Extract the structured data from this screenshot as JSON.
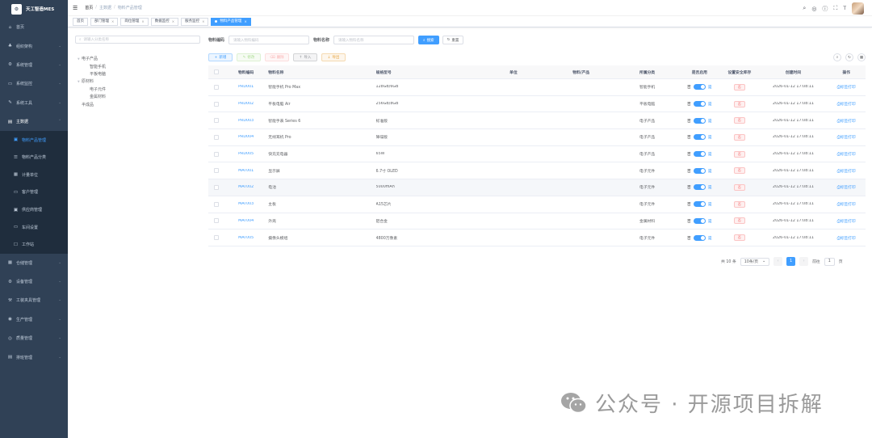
{
  "app": {
    "title": "天工智造MES"
  },
  "sidebar": {
    "items": [
      {
        "label": "首页",
        "icon": "home-icon",
        "glyph": "⌂",
        "has_arrow": false
      },
      {
        "label": "组织架构",
        "icon": "org-icon",
        "glyph": "♣",
        "has_arrow": true
      },
      {
        "label": "系统管理",
        "icon": "gear-icon",
        "glyph": "⚙",
        "has_arrow": true
      },
      {
        "label": "系统监控",
        "icon": "monitor-icon",
        "glyph": "▭",
        "has_arrow": true
      },
      {
        "label": "系统工具",
        "icon": "tool-icon",
        "glyph": "✎",
        "has_arrow": true
      },
      {
        "label": "主数据",
        "icon": "data-icon",
        "glyph": "▤",
        "has_arrow": true,
        "open": true
      }
    ],
    "subitems": [
      {
        "label": "物料产品管理",
        "icon": "product-icon",
        "glyph": "▣",
        "active": true
      },
      {
        "label": "物料产品分类",
        "icon": "category-icon",
        "glyph": "☰"
      },
      {
        "label": "计量单位",
        "icon": "unit-icon",
        "glyph": "▦"
      },
      {
        "label": "客户管理",
        "icon": "customer-icon",
        "glyph": "▭"
      },
      {
        "label": "供应商管理",
        "icon": "supplier-icon",
        "glyph": "▣"
      },
      {
        "label": "车间设置",
        "icon": "workshop-icon",
        "glyph": "▭"
      },
      {
        "label": "工作站",
        "icon": "workstation-icon",
        "glyph": "☐"
      }
    ],
    "items2": [
      {
        "label": "仓储管理",
        "icon": "warehouse-icon",
        "glyph": "▦"
      },
      {
        "label": "设备管理",
        "icon": "device-icon",
        "glyph": "⚙"
      },
      {
        "label": "工装夹具管理",
        "icon": "fixture-icon",
        "glyph": "⚒"
      },
      {
        "label": "生产管理",
        "icon": "production-icon",
        "glyph": "◉"
      },
      {
        "label": "质量管理",
        "icon": "quality-icon",
        "glyph": "◎"
      },
      {
        "label": "排班管理",
        "icon": "schedule-icon",
        "glyph": "▤"
      }
    ]
  },
  "breadcrumb": {
    "items": [
      "首页",
      "主数据",
      "物料产品管理"
    ]
  },
  "tags": [
    {
      "label": "首页",
      "closable": false
    },
    {
      "label": "部门管理",
      "closable": true
    },
    {
      "label": "岗位管理",
      "closable": true
    },
    {
      "label": "数据监控",
      "closable": true
    },
    {
      "label": "服务监控",
      "closable": true
    },
    {
      "label": "物料产品管理",
      "closable": true,
      "active": true
    }
  ],
  "tree": {
    "search_placeholder": "请输入分类名称",
    "nodes": [
      {
        "label": "电子产品",
        "level": 0,
        "caret": true
      },
      {
        "label": "智能手机",
        "level": 1
      },
      {
        "label": "平板电脑",
        "level": 1
      },
      {
        "label": "原材料",
        "level": 0,
        "caret": true
      },
      {
        "label": "电子元件",
        "level": 1
      },
      {
        "label": "金属材料",
        "level": 1
      },
      {
        "label": "半成品",
        "level": 0
      }
    ]
  },
  "search": {
    "code_label": "物料编码",
    "code_placeholder": "请输入物料编码",
    "name_label": "物料名称",
    "name_placeholder": "请输入物料名称",
    "search_btn": "搜索",
    "reset_btn": "重置"
  },
  "toolbar": {
    "add": "新增",
    "edit": "修改",
    "delete": "删除",
    "import": "导入",
    "export": "导出"
  },
  "table": {
    "headers": [
      "物料编码",
      "物料名称",
      "规格型号",
      "单位",
      "物料/产品",
      "所属分类",
      "是否启用",
      "设置安全库存",
      "创建时间",
      "操作"
    ],
    "switch_no": "否",
    "switch_yes": "是",
    "safe_btn": "否",
    "action": "标签打印",
    "rows": [
      {
        "code": "PRD001",
        "name": "智能手机 Pro Max",
        "spec": "128GB/6GB",
        "unit": "",
        "type": "",
        "category": "智能手机",
        "created": "2026-01-12 17:08:11"
      },
      {
        "code": "PRD002",
        "name": "平板电脑 Air",
        "spec": "256GB/8GB",
        "unit": "",
        "type": "",
        "category": "平板电脑",
        "created": "2026-01-12 17:08:11"
      },
      {
        "code": "PRD003",
        "name": "智能手表 Series 6",
        "spec": "标准版",
        "unit": "",
        "type": "",
        "category": "电子产品",
        "created": "2026-01-12 17:08:11"
      },
      {
        "code": "PRD004",
        "name": "无线耳机 Pro",
        "spec": "降噪版",
        "unit": "",
        "type": "",
        "category": "电子产品",
        "created": "2026-01-12 17:08:11"
      },
      {
        "code": "PRD005",
        "name": "快充充电器",
        "spec": "65W",
        "unit": "",
        "type": "",
        "category": "电子产品",
        "created": "2026-01-12 17:08:11"
      },
      {
        "code": "MAT001",
        "name": "显示屏",
        "spec": "6.7寸 OLED",
        "unit": "",
        "type": "",
        "category": "电子元件",
        "created": "2026-01-12 17:08:11"
      },
      {
        "code": "MAT002",
        "name": "电池",
        "spec": "5000mAh",
        "unit": "",
        "type": "",
        "category": "电子元件",
        "created": "2026-01-12 17:08:11"
      },
      {
        "code": "MAT003",
        "name": "主板",
        "spec": "A15芯片",
        "unit": "",
        "type": "",
        "category": "电子元件",
        "created": "2026-01-12 17:08:11"
      },
      {
        "code": "MAT004",
        "name": "外壳",
        "spec": "铝合金",
        "unit": "",
        "type": "",
        "category": "金属材料",
        "created": "2026-01-12 17:08:11"
      },
      {
        "code": "MAT005",
        "name": "摄像头模组",
        "spec": "4800万像素",
        "unit": "",
        "type": "",
        "category": "电子元件",
        "created": "2026-01-12 17:08:11"
      }
    ]
  },
  "pager": {
    "total": "共 10 条",
    "size": "10条/页",
    "page": "1",
    "goto": "前往",
    "goto_val": "1",
    "unit": "页"
  },
  "watermark": {
    "text": "公众号 · 开源项目拆解"
  },
  "colors": {
    "sidebar": "#304156",
    "primary": "#409eff"
  }
}
